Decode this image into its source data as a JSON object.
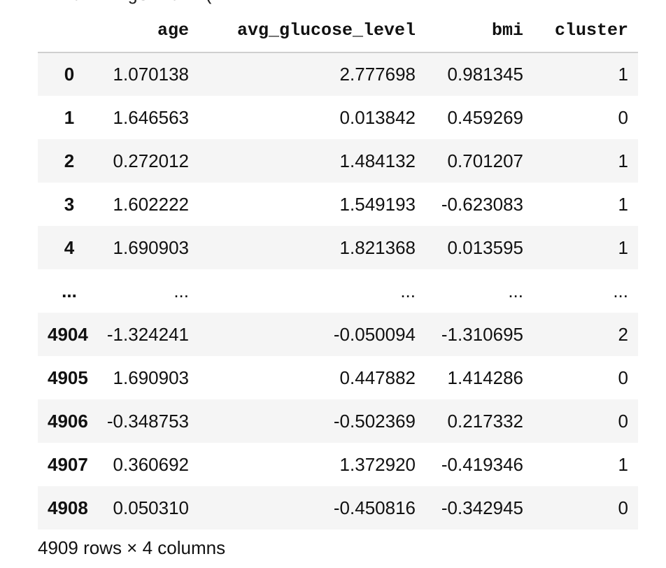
{
  "stderr_fragment": "warnings.warn(",
  "table": {
    "columns": [
      "",
      "age",
      "avg_glucose_level",
      "bmi",
      "cluster"
    ],
    "rows": [
      {
        "index": "0",
        "age": "1.070138",
        "avg_glucose_level": "2.777698",
        "bmi": "0.981345",
        "cluster": "1"
      },
      {
        "index": "1",
        "age": "1.646563",
        "avg_glucose_level": "0.013842",
        "bmi": "0.459269",
        "cluster": "0"
      },
      {
        "index": "2",
        "age": "0.272012",
        "avg_glucose_level": "1.484132",
        "bmi": "0.701207",
        "cluster": "1"
      },
      {
        "index": "3",
        "age": "1.602222",
        "avg_glucose_level": "1.549193",
        "bmi": "-0.623083",
        "cluster": "1"
      },
      {
        "index": "4",
        "age": "1.690903",
        "avg_glucose_level": "1.821368",
        "bmi": "0.013595",
        "cluster": "1"
      },
      {
        "index": "...",
        "age": "...",
        "avg_glucose_level": "...",
        "bmi": "...",
        "cluster": "..."
      },
      {
        "index": "4904",
        "age": "-1.324241",
        "avg_glucose_level": "-0.050094",
        "bmi": "-1.310695",
        "cluster": "2"
      },
      {
        "index": "4905",
        "age": "1.690903",
        "avg_glucose_level": "0.447882",
        "bmi": "1.414286",
        "cluster": "0"
      },
      {
        "index": "4906",
        "age": "-0.348753",
        "avg_glucose_level": "-0.502369",
        "bmi": "0.217332",
        "cluster": "0"
      },
      {
        "index": "4907",
        "age": "0.360692",
        "avg_glucose_level": "1.372920",
        "bmi": "-0.419346",
        "cluster": "1"
      },
      {
        "index": "4908",
        "age": "0.050310",
        "avg_glucose_level": "-0.450816",
        "bmi": "-0.342945",
        "cluster": "0"
      }
    ]
  },
  "footer": "4909 rows × 4 columns"
}
